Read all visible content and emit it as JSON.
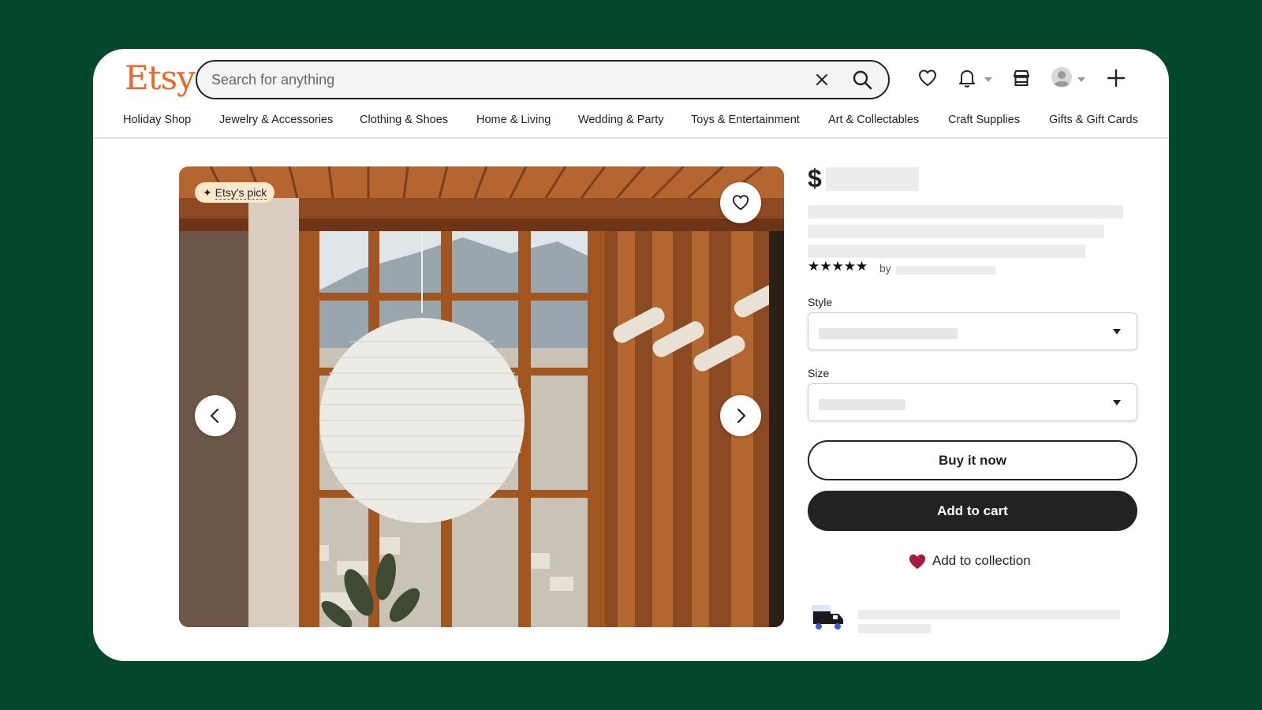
{
  "header": {
    "logo": "Etsy",
    "search_placeholder": "Search for anything"
  },
  "nav": {
    "items": [
      "Holiday Shop",
      "Jewelry & Accessories",
      "Clothing & Shoes",
      "Home & Living",
      "Wedding & Party",
      "Toys & Entertainment",
      "Art & Collectables",
      "Craft Supplies",
      "Gifts & Gift Cards"
    ]
  },
  "gallery": {
    "badge": "Etsy's pick"
  },
  "product": {
    "currency": "$",
    "rating_stars": "★★★★★",
    "by_label": "by",
    "style_label": "Style",
    "size_label": "Size",
    "buy_now": "Buy it now",
    "add_to_cart": "Add to cart",
    "add_to_collection": "Add to collection"
  },
  "colors": {
    "page_background": "#03482a",
    "brand_orange": "#e8692a",
    "collection_heart": "#a61a3e",
    "dark_button": "#222222"
  },
  "icons": [
    "heart-icon",
    "bell-icon",
    "shop-icon",
    "avatar",
    "plus-icon",
    "close-icon",
    "search-icon",
    "chevron-left-icon",
    "chevron-right-icon",
    "sparkle-icon",
    "truck-icon"
  ]
}
